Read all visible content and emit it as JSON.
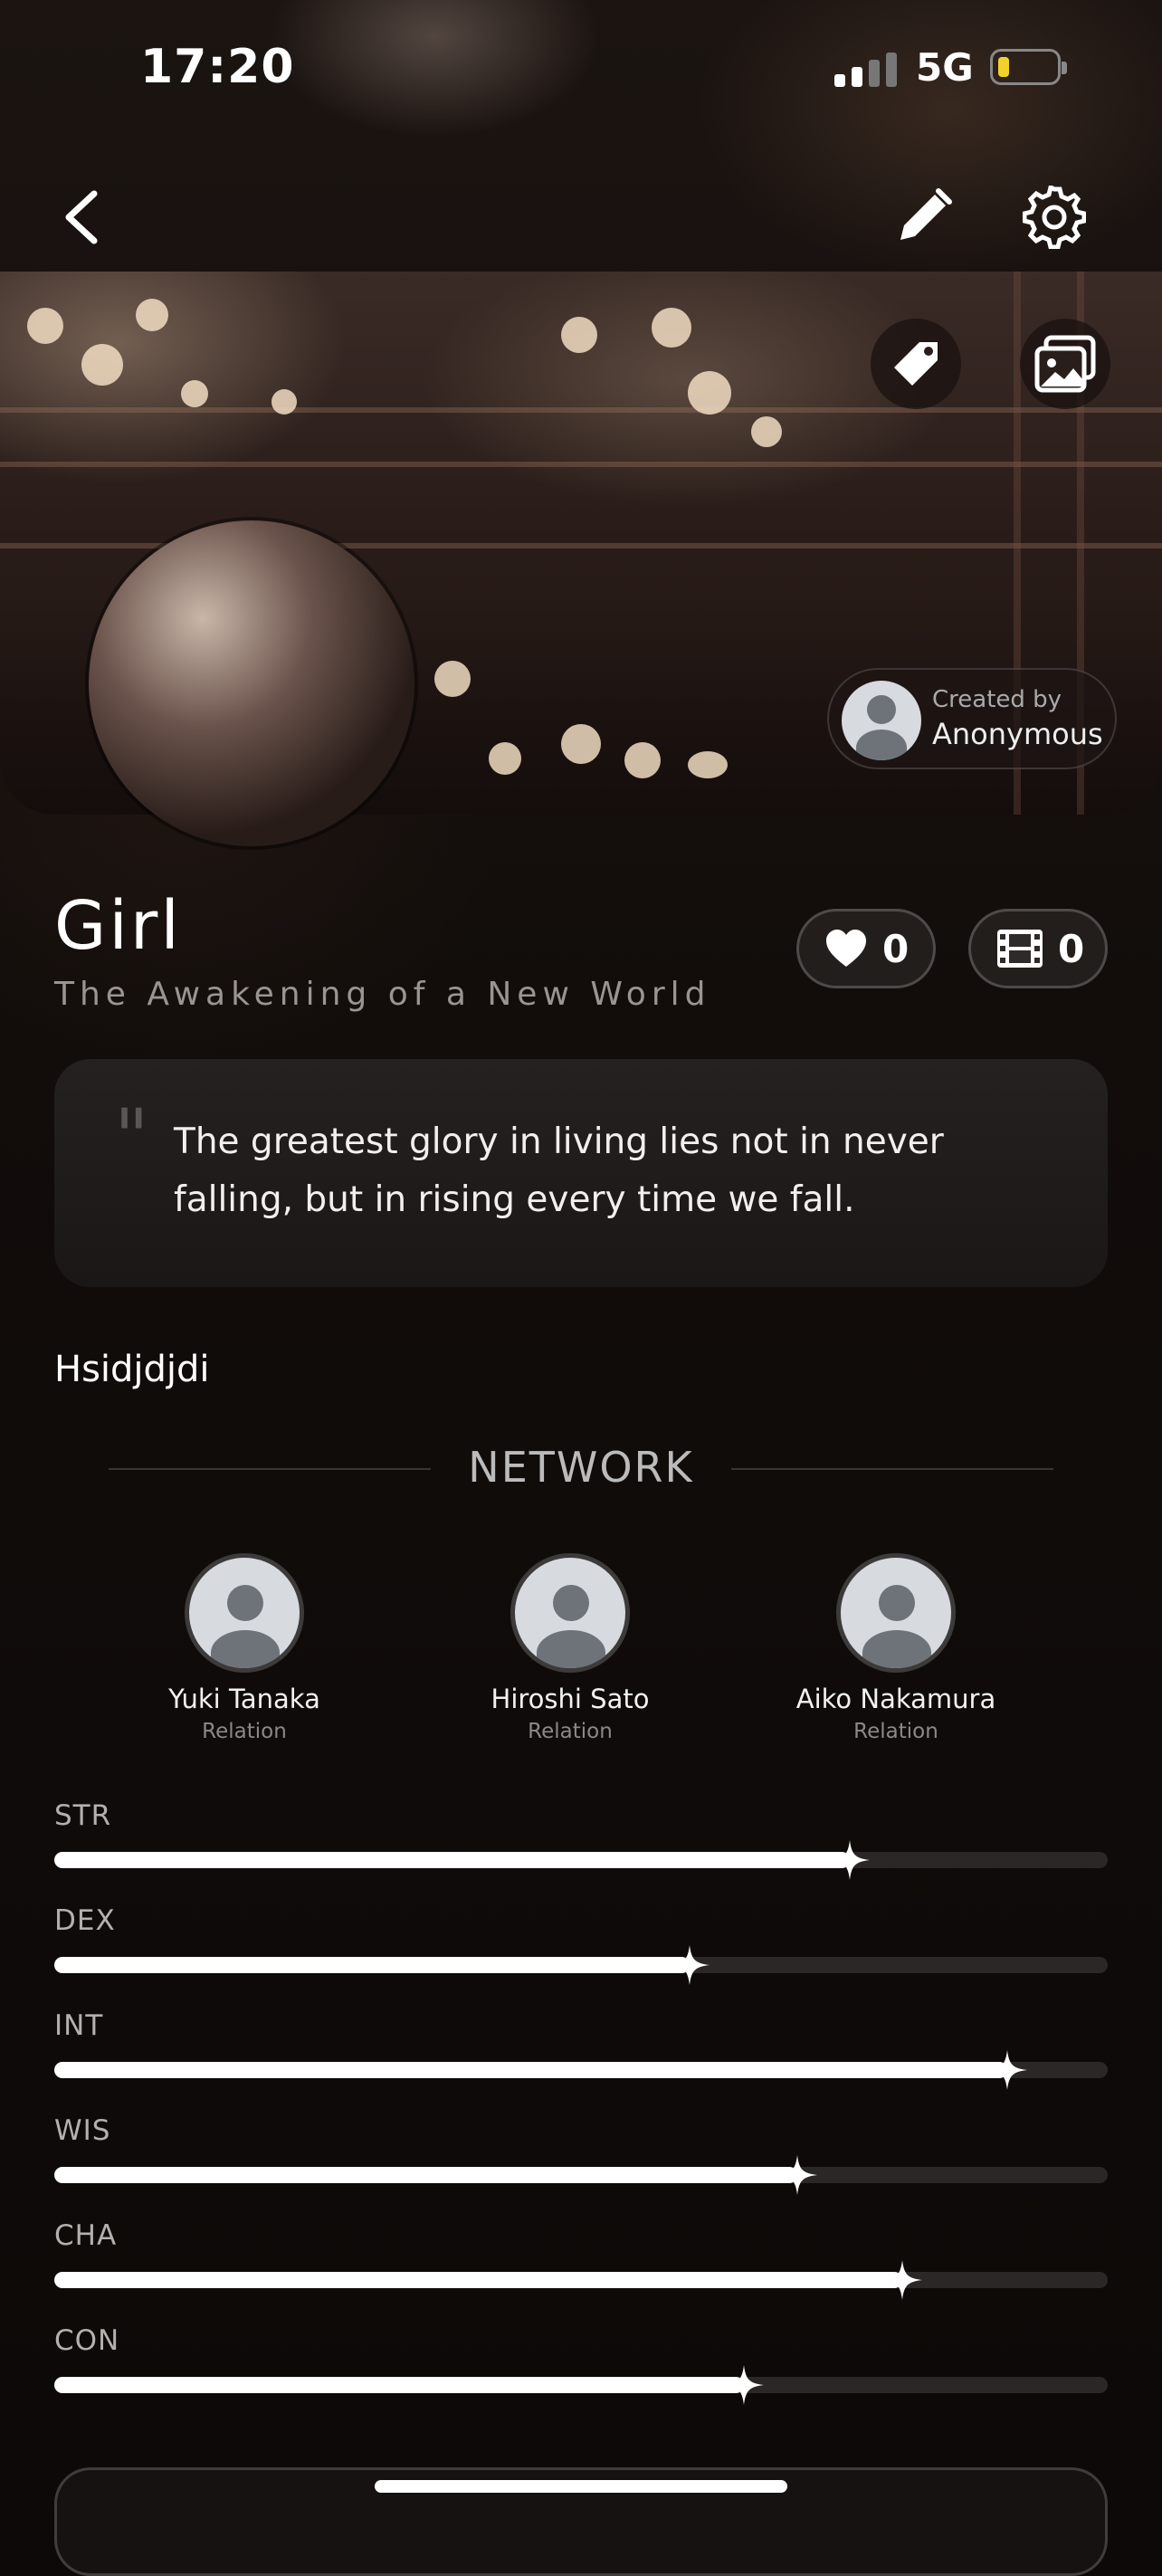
{
  "status_bar": {
    "time": "17:20",
    "network": "5G"
  },
  "header": {
    "back_icon": "chevron-left-icon",
    "edit_icon": "pencil-icon",
    "settings_icon": "gear-icon"
  },
  "banner": {
    "tag_icon": "tag-icon",
    "gallery_icon": "image-icon"
  },
  "creator": {
    "label": "Created by",
    "name": "Anonymous"
  },
  "profile": {
    "name": "Girl",
    "subtitle": "The Awakening of a New World",
    "likes": "0",
    "videos": "0"
  },
  "quote": {
    "mark": "\"",
    "text": "The greatest glory in living lies not in never falling, but in rising every time we fall."
  },
  "description": "Hsidjdjdi",
  "network": {
    "title": "NETWORK",
    "people": [
      {
        "name": "Yuki Tanaka",
        "relation": "Relation"
      },
      {
        "name": "Hiroshi Sato",
        "relation": "Relation"
      },
      {
        "name": "Aiko Nakamura",
        "relation": "Relation"
      }
    ]
  },
  "stats": [
    {
      "label": "STR",
      "value": 0.755
    },
    {
      "label": "DEX",
      "value": 0.603
    },
    {
      "label": "INT",
      "value": 0.905
    },
    {
      "label": "WIS",
      "value": 0.705
    },
    {
      "label": "CHA",
      "value": 0.805
    },
    {
      "label": "CON",
      "value": 0.655
    }
  ],
  "colors": {
    "accent": "#ffffff",
    "track": "#2b2726",
    "battery": "#f3d12c"
  }
}
